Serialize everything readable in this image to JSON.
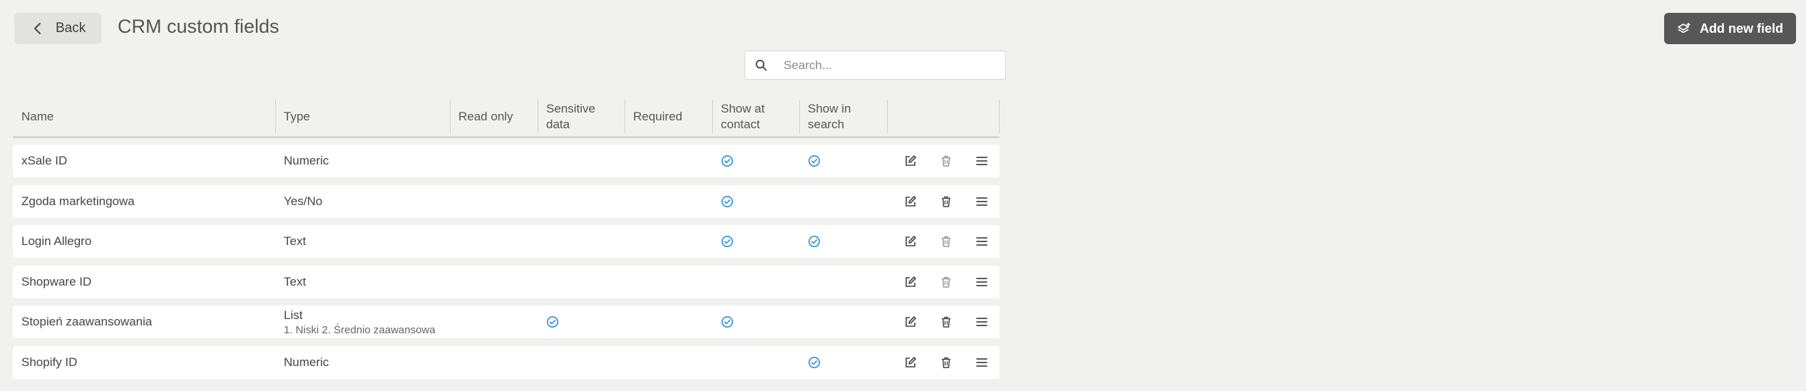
{
  "header": {
    "back_label": "Back",
    "title": "CRM custom fields",
    "add_label": "Add new field"
  },
  "search": {
    "placeholder": "Search..."
  },
  "table": {
    "columns": [
      "Name",
      "Type",
      "Read only",
      "Sensitive data",
      "Required",
      "Show at contact",
      "Show in search"
    ],
    "rows": [
      {
        "name": "xSale ID",
        "type": "Numeric",
        "subtype": "",
        "read_only": false,
        "sensitive": false,
        "required": false,
        "show_contact": true,
        "show_search": true,
        "delete_enabled": false
      },
      {
        "name": "Zgoda marketingowa",
        "type": "Yes/No",
        "subtype": "",
        "read_only": false,
        "sensitive": false,
        "required": false,
        "show_contact": true,
        "show_search": false,
        "delete_enabled": true
      },
      {
        "name": "Login Allegro",
        "type": "Text",
        "subtype": "",
        "read_only": false,
        "sensitive": false,
        "required": false,
        "show_contact": true,
        "show_search": true,
        "delete_enabled": false
      },
      {
        "name": "Shopware ID",
        "type": "Text",
        "subtype": "",
        "read_only": false,
        "sensitive": false,
        "required": false,
        "show_contact": false,
        "show_search": false,
        "delete_enabled": false
      },
      {
        "name": "Stopień zaawansowania",
        "type": "List",
        "subtype": "1. Niski 2. Średnio zaawansowa",
        "read_only": false,
        "sensitive": true,
        "required": false,
        "show_contact": true,
        "show_search": false,
        "delete_enabled": true
      },
      {
        "name": "Shopify ID",
        "type": "Numeric",
        "subtype": "",
        "read_only": false,
        "sensitive": false,
        "required": false,
        "show_contact": false,
        "show_search": true,
        "delete_enabled": true
      }
    ]
  },
  "colors": {
    "check": "#2a8fd6",
    "primary_button": "#575757",
    "background": "#f1f1f0"
  }
}
